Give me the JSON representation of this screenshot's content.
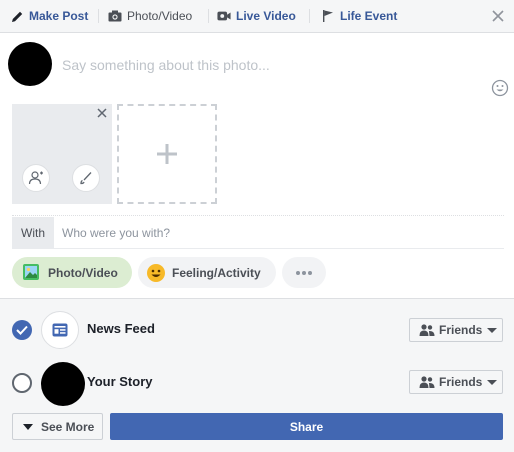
{
  "tabs": {
    "make_post": "Make Post",
    "photo_video": "Photo/Video",
    "live_video": "Live Video",
    "life_event": "Life Event"
  },
  "composer": {
    "placeholder": "Say something about this photo..."
  },
  "with": {
    "label": "With",
    "placeholder": "Who were you with?"
  },
  "chips": {
    "photo_video": "Photo/Video",
    "feeling_activity": "Feeling/Activity"
  },
  "audience": {
    "news_feed": {
      "label": "News Feed",
      "checked": true,
      "privacy": "Friends"
    },
    "your_story": {
      "label": "Your Story",
      "checked": false,
      "privacy": "Friends"
    }
  },
  "actions": {
    "see_more": "See More",
    "share": "Share"
  },
  "colors": {
    "accent": "#4267b2",
    "link": "#385898",
    "photo_chip_bg": "#dcedd2"
  }
}
